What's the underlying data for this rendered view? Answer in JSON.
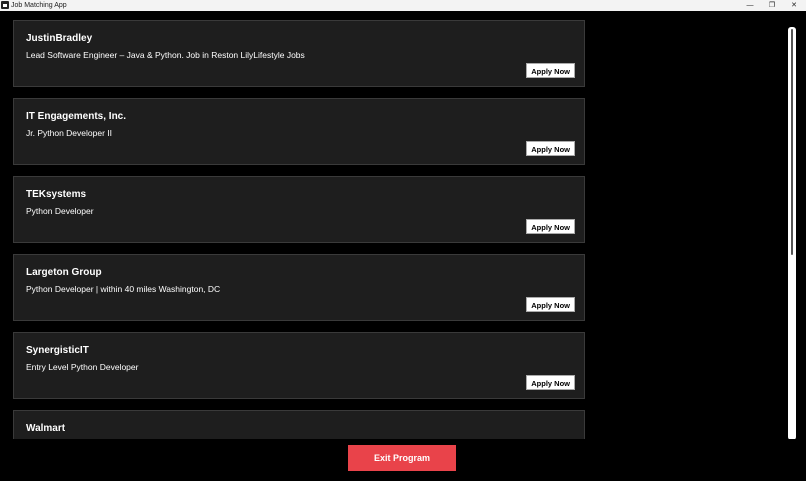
{
  "window": {
    "title": "Job Matching App",
    "minimize": "—",
    "restore": "❐",
    "close": "✕"
  },
  "jobs": [
    {
      "company": "JustinBradley",
      "title": "Lead Software Engineer – Java & Python. Job in Reston LilyLifestyle Jobs",
      "apply_label": "Apply Now"
    },
    {
      "company": "IT Engagements, Inc.",
      "title": "Jr. Python Developer II",
      "apply_label": "Apply Now"
    },
    {
      "company": "TEKsystems",
      "title": "Python Developer",
      "apply_label": "Apply Now"
    },
    {
      "company": "Largeton Group",
      "title": "Python Developer | within 40 miles Washington, DC",
      "apply_label": "Apply Now"
    },
    {
      "company": "SynergisticIT",
      "title": "Entry Level Python Developer",
      "apply_label": "Apply Now"
    },
    {
      "company": "Walmart",
      "title": "",
      "apply_label": ""
    }
  ],
  "exit_label": "Exit Program",
  "colors": {
    "exit_button": "#e9434a",
    "card_bg": "#1e1e1e",
    "background": "#000000"
  }
}
